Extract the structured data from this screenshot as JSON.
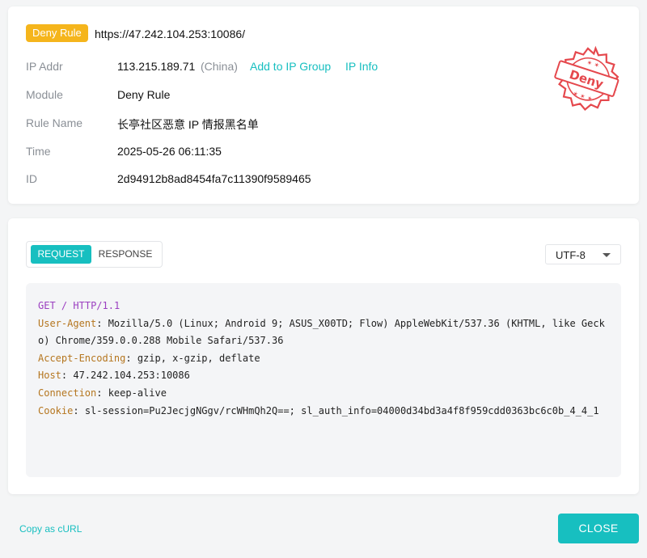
{
  "summary": {
    "badge": "Deny Rule",
    "url": "https://47.242.104.253:10086/",
    "ip": {
      "label": "IP Addr",
      "value": "113.215.189.71",
      "country": "(China)",
      "add_group_link": "Add to IP Group",
      "info_link": "IP Info"
    },
    "module": {
      "label": "Module",
      "value": "Deny Rule"
    },
    "rule_name": {
      "label": "Rule Name",
      "value": "长亭社区恶意 IP 情报黑名单"
    },
    "time": {
      "label": "Time",
      "value": "2025-05-26 06:11:35"
    },
    "id": {
      "label": "ID",
      "value": "2d94912b8ad8454fa7c11390f9589465"
    },
    "stamp": {
      "text": "Deny",
      "color": "#e5484d"
    }
  },
  "detail": {
    "tabs": [
      {
        "label": "REQUEST",
        "active": true
      },
      {
        "label": "RESPONSE",
        "active": false
      }
    ],
    "encoding": "UTF-8",
    "request": {
      "method": "GET",
      "path": "/",
      "protocol": "HTTP/1.1",
      "headers": [
        {
          "name": "User-Agent",
          "value": "Mozilla/5.0 (Linux; Android 9; ASUS_X00TD; Flow) AppleWebKit/537.36 (KHTML, like Gecko) Chrome/359.0.0.288 Mobile Safari/537.36"
        },
        {
          "name": "Accept-Encoding",
          "value": "gzip, x-gzip, deflate"
        },
        {
          "name": "Host",
          "value": "47.242.104.253:10086"
        },
        {
          "name": "Connection",
          "value": "keep-alive"
        },
        {
          "name": "Cookie",
          "value": "sl-session=Pu2JecjgNGgv/rcWHmQh2Q==; sl_auth_info=04000d34bd3a4f8f959cdd0363bc6c0b_4_4_1"
        }
      ]
    }
  },
  "footer": {
    "copy_curl": "Copy as cURL",
    "close": "CLOSE"
  },
  "colors": {
    "accent": "#17bfc0",
    "badge": "#f5b51c",
    "stamp": "#e5484d",
    "method": "#9b3fc0",
    "header_name": "#b5761f"
  }
}
